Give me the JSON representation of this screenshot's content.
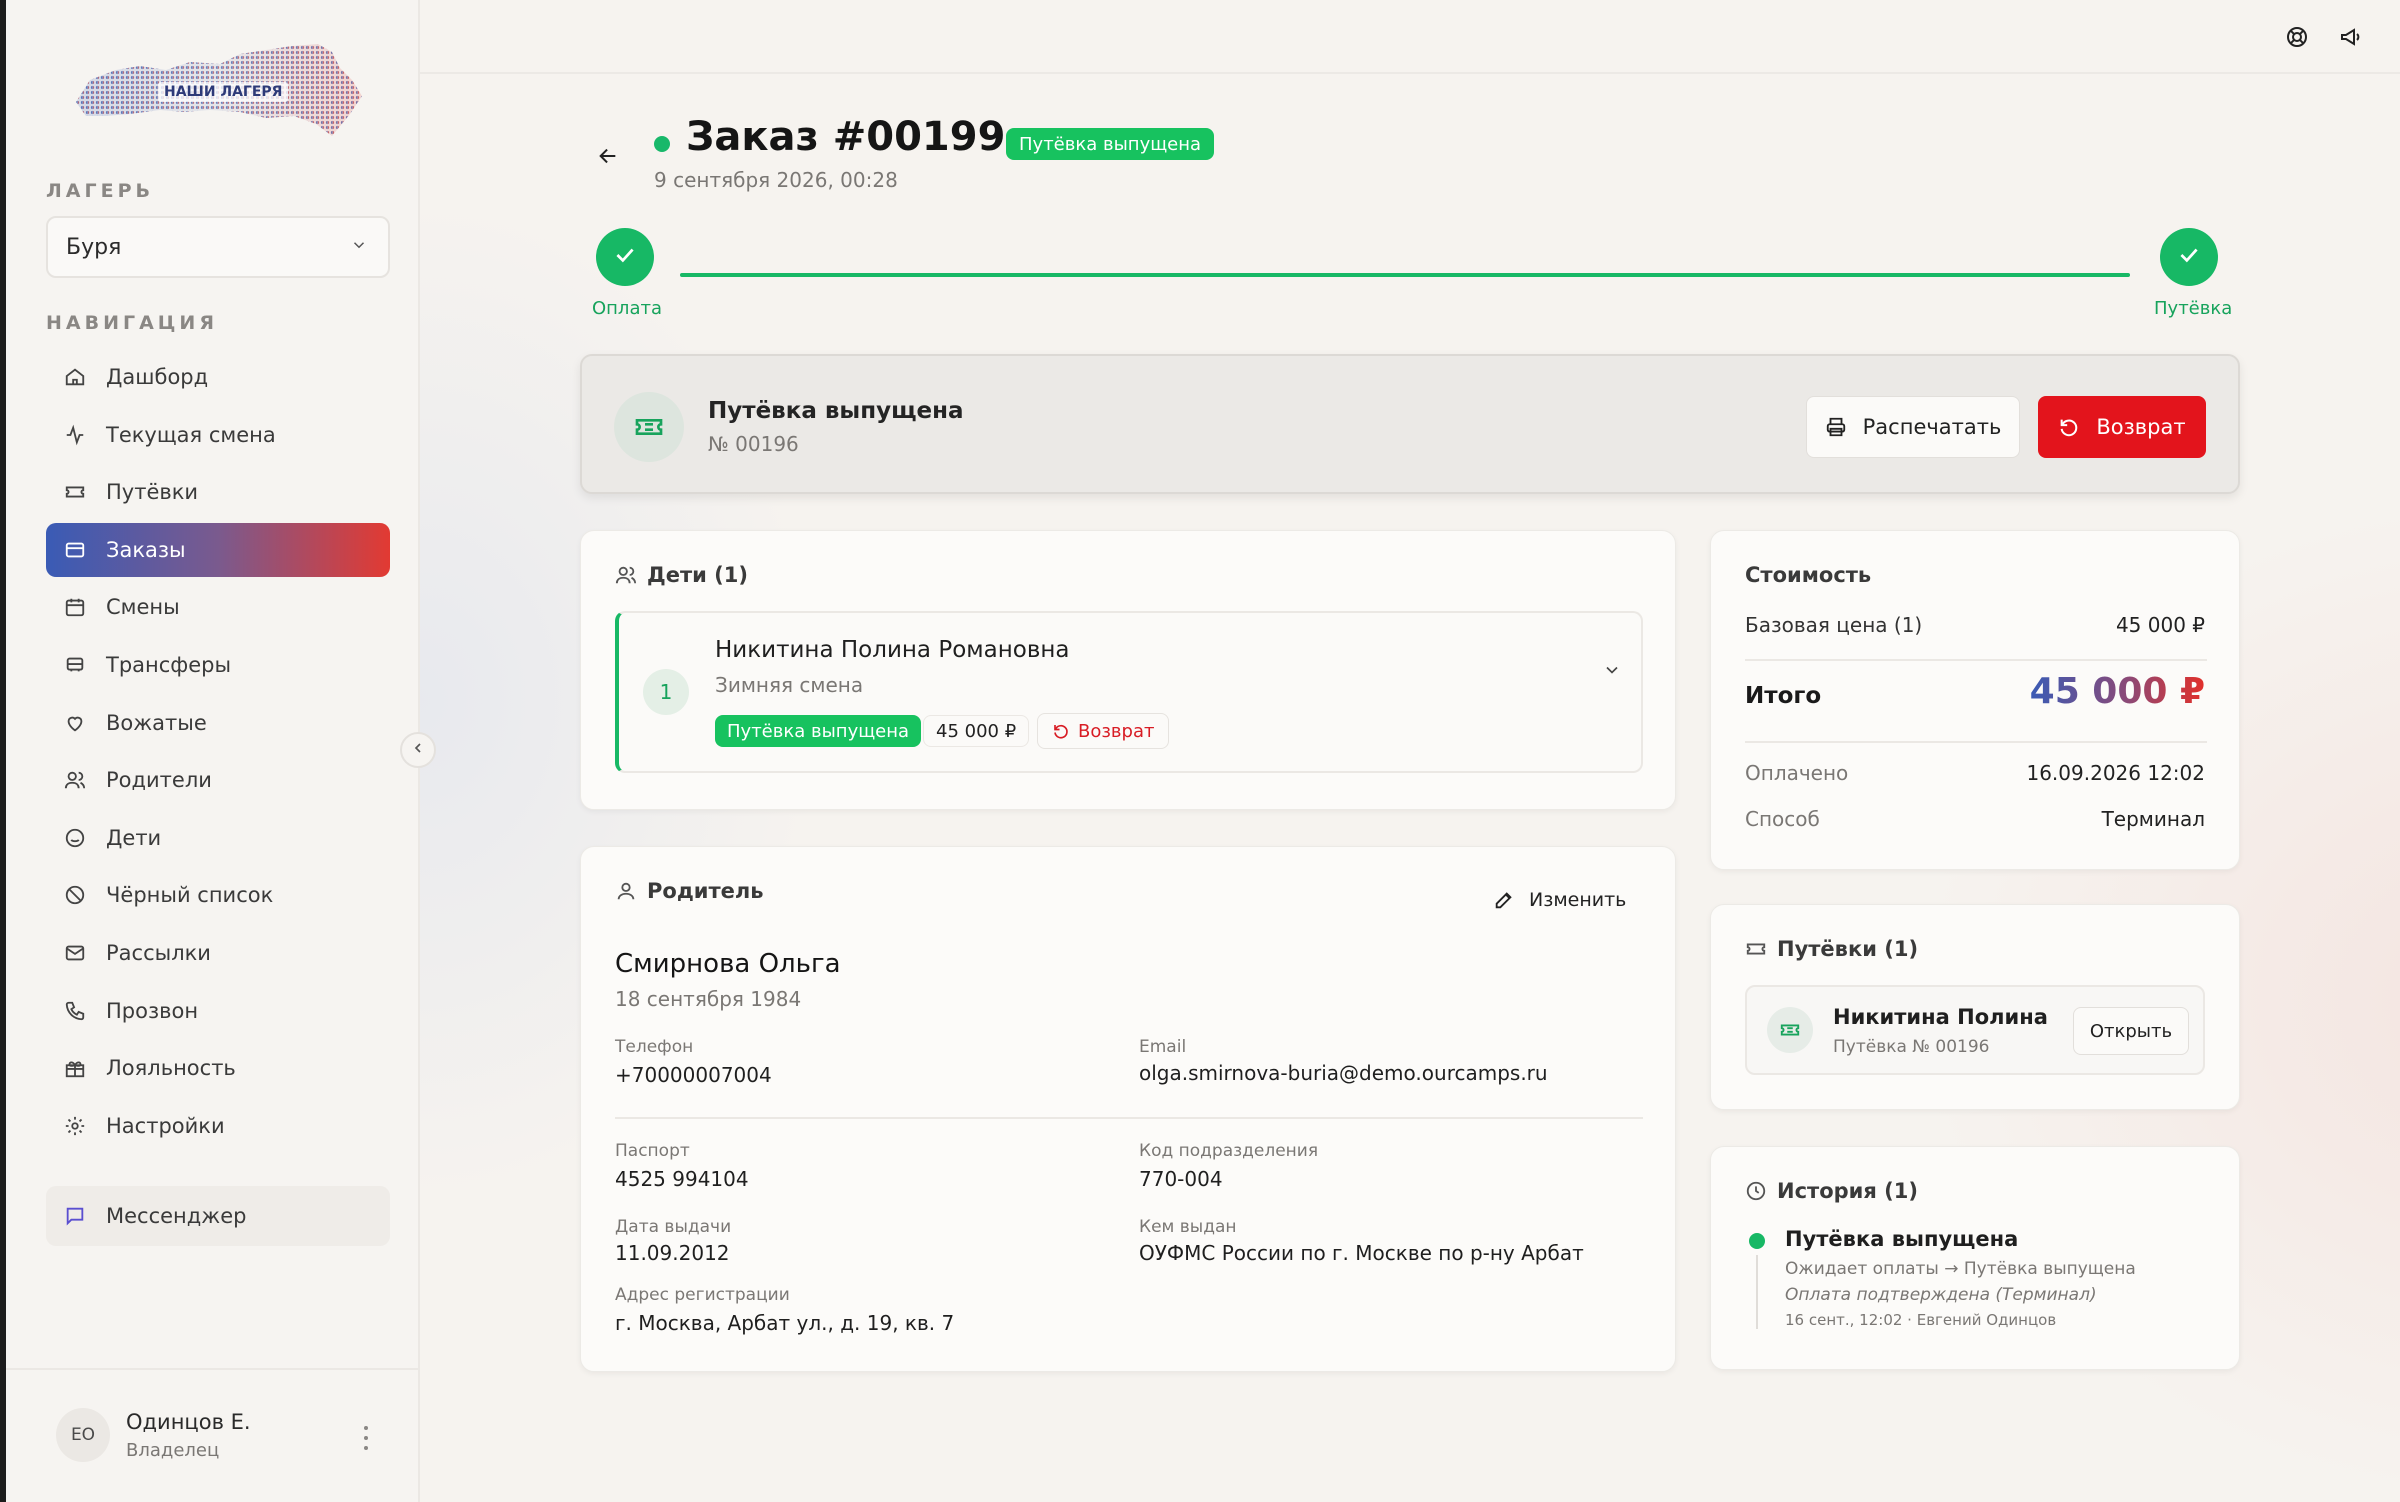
{
  "sidebar": {
    "logo_text": "НАШИ ЛАГЕРЯ",
    "camp_label": "ЛАГЕРЬ",
    "camp_value": "Буря",
    "nav_label": "НАВИГАЦИЯ",
    "items": [
      {
        "label": "Дашборд",
        "icon": "home-icon"
      },
      {
        "label": "Текущая смена",
        "icon": "activity-icon"
      },
      {
        "label": "Путёвки",
        "icon": "ticket-icon"
      },
      {
        "label": "Заказы",
        "icon": "card-icon",
        "active": true
      },
      {
        "label": "Смены",
        "icon": "calendar-icon"
      },
      {
        "label": "Трансферы",
        "icon": "bus-icon"
      },
      {
        "label": "Вожатые",
        "icon": "heart-hand-icon"
      },
      {
        "label": "Родители",
        "icon": "users-icon"
      },
      {
        "label": "Дети",
        "icon": "smile-icon"
      },
      {
        "label": "Чёрный список",
        "icon": "ban-icon"
      },
      {
        "label": "Рассылки",
        "icon": "mail-icon"
      },
      {
        "label": "Прозвон",
        "icon": "phone-icon"
      },
      {
        "label": "Лояльность",
        "icon": "gift-icon"
      },
      {
        "label": "Настройки",
        "icon": "gear-icon"
      }
    ],
    "messenger": "Мессенджер",
    "user": {
      "initials": "ЕО",
      "name": "Одинцов Е.",
      "role": "Владелец"
    }
  },
  "order": {
    "title": "Заказ #00199",
    "status": "Путёвка выпущена",
    "date": "9 сентября 2026, 00:28"
  },
  "steps": {
    "pay": "Оплата",
    "voucher": "Путёвка"
  },
  "banner": {
    "title": "Путёвка выпущена",
    "number": "№ 00196",
    "print": "Распечатать",
    "refund": "Возврат"
  },
  "children": {
    "title": "Дети (1)",
    "items": [
      {
        "num": "1",
        "name": "Никитина Полина Романовна",
        "shift": "Зимняя смена",
        "status": "Путёвка выпущена",
        "price": "45 000 ₽",
        "refund": "Возврат"
      }
    ]
  },
  "parent": {
    "title": "Родитель",
    "edit": "Изменить",
    "name": "Смирнова Ольга",
    "dob": "18 сентября 1984",
    "phone_label": "Телефон",
    "phone": "+70000007004",
    "email_label": "Email",
    "email": "olga.smirnova-buria@demo.ourcamps.ru",
    "passport_label": "Паспорт",
    "passport": "4525 994104",
    "code_label": "Код подразделения",
    "code": "770-004",
    "issue_date_label": "Дата выдачи",
    "issue_date": "11.09.2012",
    "issued_by_label": "Кем выдан",
    "issued_by": "ОУФМС России по г. Москве по р-ну Арбат",
    "address_label": "Адрес регистрации",
    "address": "г. Москва, Арбат ул., д. 19, кв. 7"
  },
  "cost": {
    "title": "Стоимость",
    "base_label": "Базовая цена (1)",
    "base_value": "45 000 ₽",
    "total_label": "Итого",
    "total_value": "45 000 ₽",
    "paid_label": "Оплачено",
    "paid_value": "16.09.2026 12:02",
    "method_label": "Способ",
    "method_value": "Терминал"
  },
  "vouchers": {
    "title": "Путёвки (1)",
    "items": [
      {
        "name": "Никитина Полина",
        "sub": "Путёвка № 00196",
        "open": "Открыть"
      }
    ]
  },
  "history": {
    "title": "История (1)",
    "items": [
      {
        "title": "Путёвка выпущена",
        "transition": "Ожидает оплаты → Путёвка выпущена",
        "note": "Оплата подтверждена (Терминал)",
        "meta": "16 сент., 12:02  ·  Евгений Одинцов"
      }
    ]
  },
  "colors": {
    "accent_green": "#17b865",
    "refund_red": "#e3141c",
    "brand_blue": "#3a5bb5",
    "brand_red": "#e23a32"
  }
}
